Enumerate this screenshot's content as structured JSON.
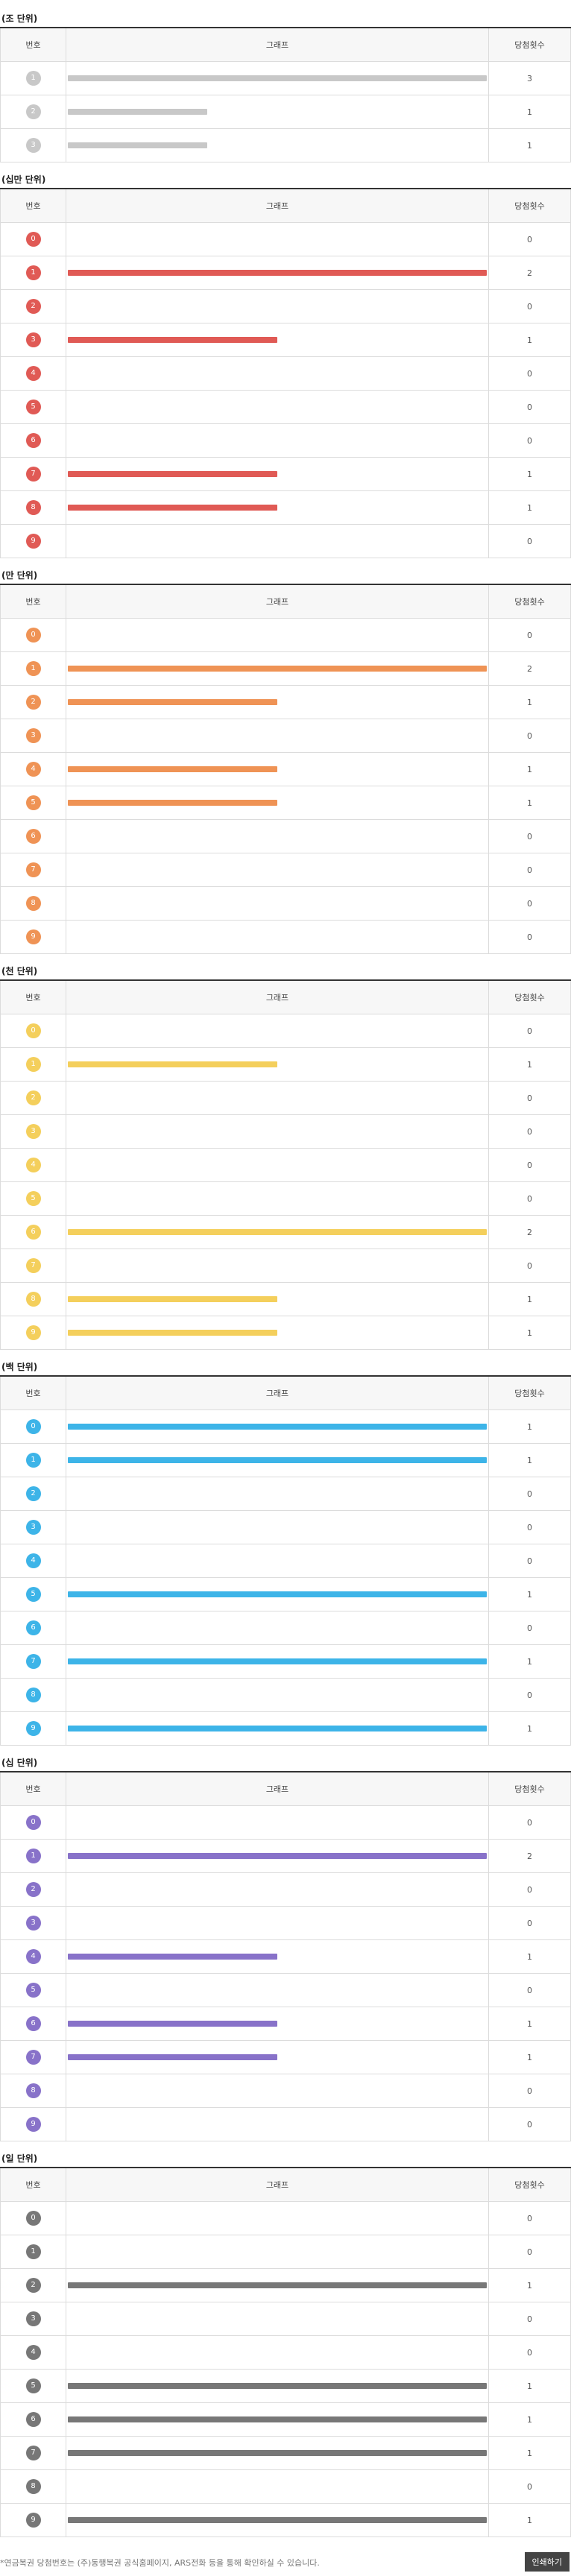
{
  "header": {
    "col_number": "번호",
    "col_graph": "그래프",
    "col_count": "당첨횟수"
  },
  "sections": [
    {
      "title": "(조 단위)",
      "color": "#c8c8c8",
      "rows": [
        {
          "n": "1",
          "count": 3
        },
        {
          "n": "2",
          "count": 1
        },
        {
          "n": "3",
          "count": 1
        }
      ]
    },
    {
      "title": "(십만 단위)",
      "color": "#e05a55",
      "rows": [
        {
          "n": "0",
          "count": 0
        },
        {
          "n": "1",
          "count": 2
        },
        {
          "n": "2",
          "count": 0
        },
        {
          "n": "3",
          "count": 1
        },
        {
          "n": "4",
          "count": 0
        },
        {
          "n": "5",
          "count": 0
        },
        {
          "n": "6",
          "count": 0
        },
        {
          "n": "7",
          "count": 1
        },
        {
          "n": "8",
          "count": 1
        },
        {
          "n": "9",
          "count": 0
        }
      ]
    },
    {
      "title": "(만 단위)",
      "color": "#ef9355",
      "rows": [
        {
          "n": "0",
          "count": 0
        },
        {
          "n": "1",
          "count": 2
        },
        {
          "n": "2",
          "count": 1
        },
        {
          "n": "3",
          "count": 0
        },
        {
          "n": "4",
          "count": 1
        },
        {
          "n": "5",
          "count": 1
        },
        {
          "n": "6",
          "count": 0
        },
        {
          "n": "7",
          "count": 0
        },
        {
          "n": "8",
          "count": 0
        },
        {
          "n": "9",
          "count": 0
        }
      ]
    },
    {
      "title": "(천 단위)",
      "color": "#f4cf5c",
      "rows": [
        {
          "n": "0",
          "count": 0
        },
        {
          "n": "1",
          "count": 1
        },
        {
          "n": "2",
          "count": 0
        },
        {
          "n": "3",
          "count": 0
        },
        {
          "n": "4",
          "count": 0
        },
        {
          "n": "5",
          "count": 0
        },
        {
          "n": "6",
          "count": 2
        },
        {
          "n": "7",
          "count": 0
        },
        {
          "n": "8",
          "count": 1
        },
        {
          "n": "9",
          "count": 1
        }
      ]
    },
    {
      "title": "(백 단위)",
      "color": "#3db4e8",
      "rows": [
        {
          "n": "0",
          "count": 1
        },
        {
          "n": "1",
          "count": 1
        },
        {
          "n": "2",
          "count": 0
        },
        {
          "n": "3",
          "count": 0
        },
        {
          "n": "4",
          "count": 0
        },
        {
          "n": "5",
          "count": 1
        },
        {
          "n": "6",
          "count": 0
        },
        {
          "n": "7",
          "count": 1
        },
        {
          "n": "8",
          "count": 0
        },
        {
          "n": "9",
          "count": 1
        }
      ]
    },
    {
      "title": "(십 단위)",
      "color": "#8872c9",
      "rows": [
        {
          "n": "0",
          "count": 0
        },
        {
          "n": "1",
          "count": 2
        },
        {
          "n": "2",
          "count": 0
        },
        {
          "n": "3",
          "count": 0
        },
        {
          "n": "4",
          "count": 1
        },
        {
          "n": "5",
          "count": 0
        },
        {
          "n": "6",
          "count": 1
        },
        {
          "n": "7",
          "count": 1
        },
        {
          "n": "8",
          "count": 0
        },
        {
          "n": "9",
          "count": 0
        }
      ]
    },
    {
      "title": "(일 단위)",
      "color": "#777777",
      "rows": [
        {
          "n": "0",
          "count": 0
        },
        {
          "n": "1",
          "count": 0
        },
        {
          "n": "2",
          "count": 1
        },
        {
          "n": "3",
          "count": 0
        },
        {
          "n": "4",
          "count": 0
        },
        {
          "n": "5",
          "count": 1
        },
        {
          "n": "6",
          "count": 1
        },
        {
          "n": "7",
          "count": 1
        },
        {
          "n": "8",
          "count": 0
        },
        {
          "n": "9",
          "count": 1
        }
      ]
    }
  ],
  "footer": {
    "note": "*연금복권 당첨번호는 (주)동행복권 공식홈페이지, ARS전화 등을 통해 확인하실 수 있습니다.",
    "print_label": "인쇄하기"
  }
}
